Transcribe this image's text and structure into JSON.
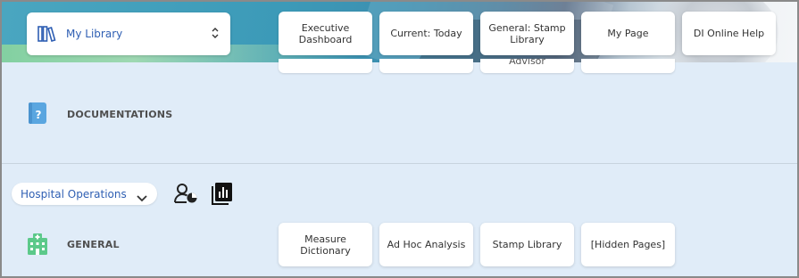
{
  "header": {
    "library_select": {
      "label": "My Library"
    },
    "tiles": [
      {
        "key": "executive-dashboard",
        "label": "Executive Dashboard"
      },
      {
        "key": "current-today",
        "label": "Current: Today"
      },
      {
        "key": "general-stamp-library",
        "label": "General: Stamp Library"
      },
      {
        "key": "my-page",
        "label": "My Page"
      },
      {
        "key": "di-online-help",
        "label": "DI Online Help"
      }
    ],
    "peek_tiles": [
      "",
      "",
      "Advisor",
      ""
    ]
  },
  "sections": {
    "documentations": {
      "title": "DOCUMENTATIONS"
    },
    "general": {
      "title": "GENERAL",
      "tiles": [
        {
          "key": "measure-dictionary",
          "label": "Measure Dictionary"
        },
        {
          "key": "ad-hoc-analysis",
          "label": "Ad Hoc Analysis"
        },
        {
          "key": "stamp-library",
          "label": "Stamp Library"
        },
        {
          "key": "hidden-pages",
          "label": "[Hidden Pages]"
        }
      ]
    }
  },
  "controls": {
    "department_select": {
      "label": "Hospital Operations"
    }
  },
  "colors": {
    "accent_text": "#2f5fb3",
    "page_background": "#e0ecf8",
    "documentation_icon": "#5aa6e0",
    "general_icon": "#5cc98a"
  },
  "icons": {
    "library": "library-books-icon",
    "updown": "up-down-chevron-icon",
    "documentation": "help-book-icon",
    "general": "hospital-building-icon",
    "dropdown": "chevron-down-icon",
    "user_report": "user-chart-icon",
    "report_book": "report-book-icon"
  }
}
